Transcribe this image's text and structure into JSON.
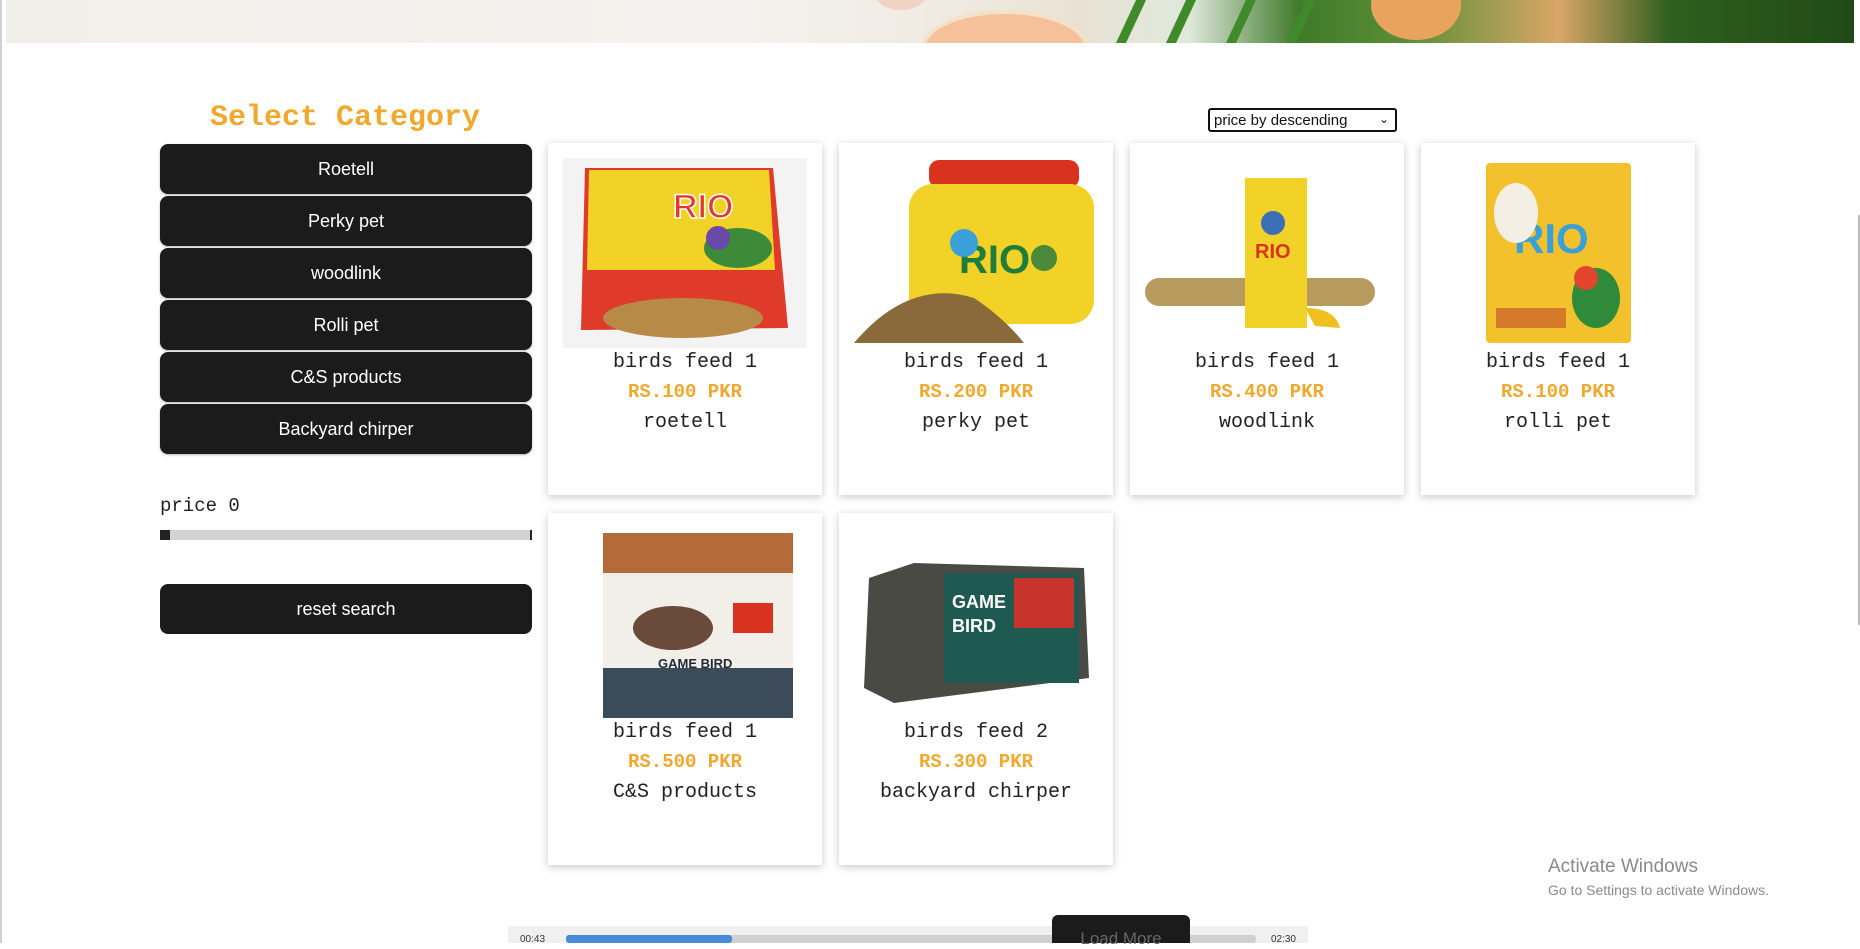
{
  "sidebar": {
    "title": "Select Category",
    "categories": [
      "Roetell",
      "Perky pet",
      "woodlink",
      "Rolli pet",
      "C&S products",
      "Backyard chirper"
    ],
    "price_label": "price 0",
    "price_value": 0,
    "reset_label": "reset search"
  },
  "sort": {
    "selected": "price by descending"
  },
  "products": [
    {
      "name": "birds feed 1",
      "price": "RS.100 PKR",
      "brand": "roetell",
      "image": "rio-exotic-birds-bag"
    },
    {
      "name": "birds feed 1",
      "price": "RS.200 PKR",
      "brand": "perky pet",
      "image": "rio-seed-jar"
    },
    {
      "name": "birds feed 1",
      "price": "RS.400 PKR",
      "brand": "woodlink",
      "image": "rio-seed-sticks"
    },
    {
      "name": "birds feed 1",
      "price": "RS.100 PKR",
      "brand": "rolli pet",
      "image": "rio-parakeets-bag"
    },
    {
      "name": "birds feed 1",
      "price": "RS.500 PKR",
      "brand": "C&S products",
      "image": "purina-game-bird-bag"
    },
    {
      "name": "birds feed 2",
      "price": "RS.300 PKR",
      "brand": "backyard chirper",
      "image": "purina-game-bird-block"
    }
  ],
  "load_more": "Load More",
  "watermark": {
    "line1": "Activate Windows",
    "line2": "Go to Settings to activate Windows."
  },
  "player": {
    "current": "00:43",
    "total": "02:30",
    "progress": 0.24
  },
  "colors": {
    "accent": "#f0a82e",
    "button_bg": "#1b1b1b"
  }
}
